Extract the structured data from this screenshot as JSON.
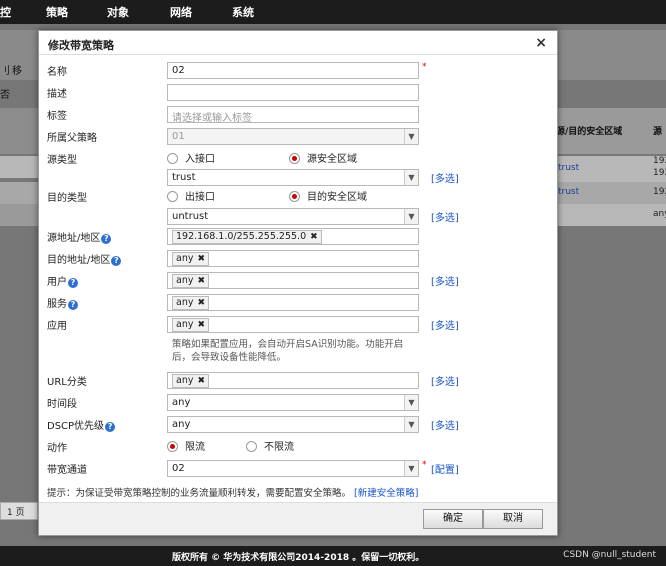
{
  "topnav": {
    "items": [
      "控",
      "策略",
      "对象",
      "网络",
      "系统"
    ]
  },
  "background": {
    "toolbar_a": "刂",
    "toolbar_b": "移",
    "toolbar_c": "否",
    "col_header_1": "源/目的安全区域",
    "col_header_2": "源",
    "rows": [
      {
        "zone": "trust",
        "addr1": "192",
        "addr2": "192"
      },
      {
        "zone": "trust",
        "addr1": "192",
        "addr2": ""
      },
      {
        "zone": "",
        "addr1": "any",
        "addr2": ""
      }
    ],
    "pager": "1 页"
  },
  "dialog": {
    "title": "修改带宽策略",
    "close": "×",
    "fields": {
      "name": {
        "label": "名称",
        "value": "02",
        "required": "*"
      },
      "desc": {
        "label": "描述",
        "value": ""
      },
      "tag": {
        "label": "标签",
        "placeholder": "请选择或输入标签"
      },
      "parent": {
        "label": "所属父策略",
        "value": "01"
      },
      "src_type": {
        "label": "源类型",
        "opt1": "入接口",
        "opt2": "源安全区域",
        "selected": "源安全区域"
      },
      "src_zone": {
        "value": "trust",
        "link": "[多选]"
      },
      "dst_type": {
        "label": "目的类型",
        "opt1": "出接口",
        "opt2": "目的安全区域",
        "selected": "目的安全区域"
      },
      "dst_zone": {
        "value": "untrust",
        "link": "[多选]"
      },
      "src_addr": {
        "label": "源地址/地区",
        "tag": "192.168.1.0/255.255.255.0"
      },
      "dst_addr": {
        "label": "目的地址/地区",
        "tag": "any"
      },
      "user": {
        "label": "用户",
        "tag": "any",
        "link": "[多选]"
      },
      "service": {
        "label": "服务",
        "tag": "any"
      },
      "app": {
        "label": "应用",
        "tag": "any",
        "link": "[多选]"
      },
      "app_note": "策略如果配置应用，会自动开启SA识别功能。功能开启后，会导致设备性能降低。",
      "url": {
        "label": "URL分类",
        "tag": "any",
        "link": "[多选]"
      },
      "time": {
        "label": "时间段",
        "value": "any"
      },
      "dscp": {
        "label": "DSCP优先级",
        "value": "any",
        "link": "[多选]"
      },
      "action": {
        "label": "动作",
        "opt1": "限流",
        "opt2": "不限流",
        "selected": "限流"
      },
      "channel": {
        "label": "带宽通道",
        "value": "02",
        "required": "*",
        "link": "[配置]"
      }
    },
    "tip": "提示：为保证受带宽策略控制的业务流量顺利转发，需要配置安全策略。",
    "tip_link": "[新建安全策略]",
    "ok": "确定",
    "cancel": "取消"
  },
  "footer": {
    "copyright": "版权所有 © 华为技术有限公司2014-2018 。保留一切权利。",
    "watermark": "CSDN @null_student"
  },
  "icons": {
    "help": "help-icon",
    "dropdown": "chevron-down-icon",
    "remove": "close-icon"
  }
}
